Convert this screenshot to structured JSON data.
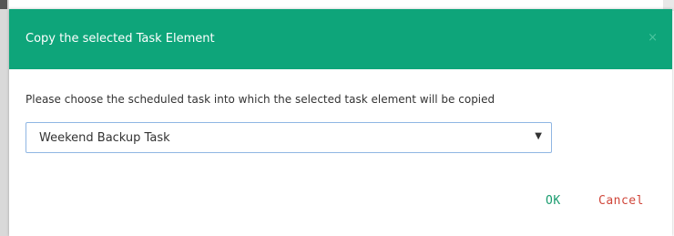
{
  "dialog": {
    "title": "Copy the selected Task Element",
    "close_glyph": "×",
    "prompt": "Please choose the scheduled task into which the selected task element will be copied",
    "select": {
      "value": "Weekend Backup Task",
      "caret": "▼"
    },
    "buttons": {
      "ok": "OK",
      "cancel": "Cancel"
    }
  },
  "colors": {
    "header_bg": "#0ea57a",
    "ok_text": "#1a9c6f",
    "cancel_text": "#d0463a",
    "select_border": "#8fb6e3"
  },
  "icons": {
    "close": "close-icon",
    "dropdown": "chevron-down-icon"
  }
}
